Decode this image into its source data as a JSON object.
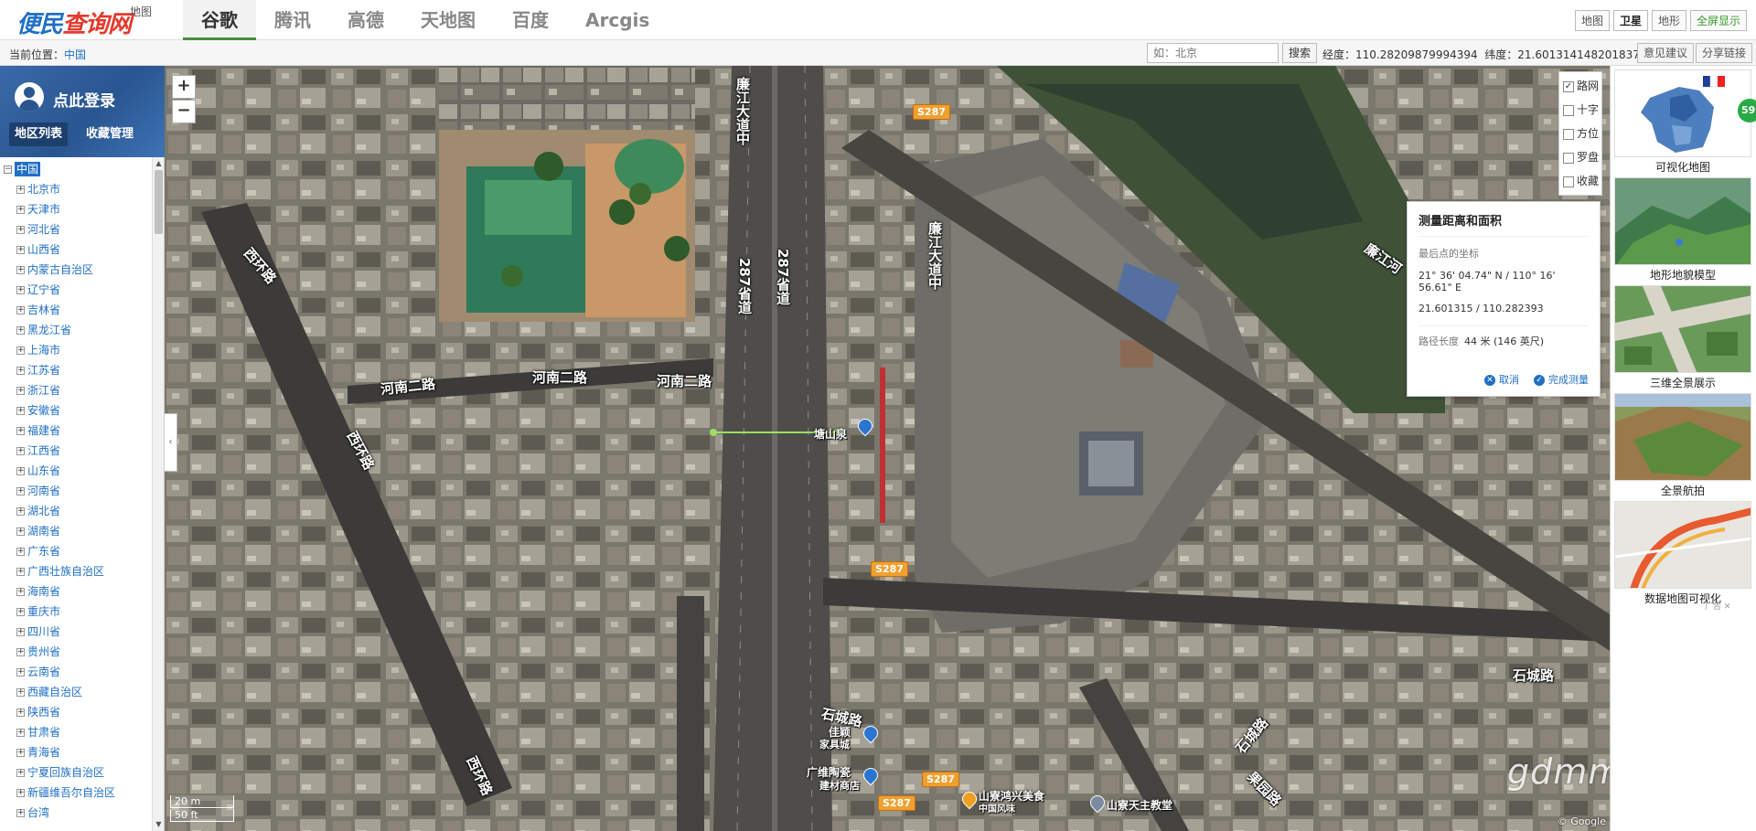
{
  "logo": {
    "text_a": "便民",
    "text_b": "查询网",
    "sub": "地图"
  },
  "tabs": [
    {
      "label": "谷歌",
      "active": true
    },
    {
      "label": "腾讯"
    },
    {
      "label": "高德"
    },
    {
      "label": "天地图"
    },
    {
      "label": "百度"
    },
    {
      "label": "Arcgis"
    }
  ],
  "view_buttons": {
    "map": "地图",
    "satellite": "卫星",
    "terrain": "地形",
    "fullscreen": "全屏显示"
  },
  "location_bar": {
    "label": "当前位置：",
    "value": "中国",
    "search_placeholder": "如：北京",
    "search_button": "搜索",
    "lng_label": "经度：",
    "lng": "110.28209879994394",
    "lat_label": "纬度：",
    "lat": "21.601314148201837",
    "feedback": "意见建议",
    "share": "分享链接"
  },
  "sidebar": {
    "login": "点此登录",
    "region_list": "地区列表",
    "favorites": "收藏管理",
    "root": "中国",
    "provinces": [
      "北京市",
      "天津市",
      "河北省",
      "山西省",
      "内蒙古自治区",
      "辽宁省",
      "吉林省",
      "黑龙江省",
      "上海市",
      "江苏省",
      "浙江省",
      "安徽省",
      "福建省",
      "江西省",
      "山东省",
      "河南省",
      "湖北省",
      "湖南省",
      "广东省",
      "广西壮族自治区",
      "海南省",
      "重庆市",
      "四川省",
      "贵州省",
      "云南省",
      "西藏自治区",
      "陕西省",
      "甘肃省",
      "青海省",
      "宁夏回族自治区",
      "新疆维吾尔自治区",
      "台湾"
    ]
  },
  "map": {
    "zoom_in": "+",
    "zoom_out": "−",
    "collapse": "‹",
    "layers": [
      {
        "label": "路网",
        "checked": true
      },
      {
        "label": "十字",
        "checked": false
      },
      {
        "label": "方位",
        "checked": false
      },
      {
        "label": "罗盘",
        "checked": false
      },
      {
        "label": "收藏",
        "checked": false
      }
    ],
    "labels": {
      "road_lianjiang_1": "廉江大道中",
      "road_lianjiang_2": "廉江大道中",
      "road_287_1": "287省道",
      "road_287_2": "287省道",
      "road_henan_1": "河南二路",
      "road_henan_2": "河南二路",
      "road_henan_3": "河南二路",
      "road_xihuan_1": "西环路",
      "road_xihuan_2": "西环路",
      "road_xihuan_3": "西环路",
      "river": "廉江河",
      "road_shicheng_1": "石城路",
      "road_shicheng_2": "石城路",
      "road_shicheng_3": "石城路",
      "road_guoyuan": "果园路"
    },
    "shields": [
      "S287",
      "S287",
      "S287",
      "S287"
    ],
    "pois": {
      "tangshanquan": "塘山泉",
      "jiaying_1": "佳颖",
      "jiaying_2": "家具城",
      "guangwei_1": "广维陶瓷",
      "guangwei_2": "建材商店",
      "shanliao_food_1": "山寮鸿兴美食",
      "shanliao_food_2": "中国风味",
      "church": "山寮天主教堂"
    },
    "measure": {
      "title": "测量距离和面积",
      "last_point_label": "最后点的坐标",
      "dms": "21° 36' 04.74\" N / 110° 16' 56.61\" E",
      "decimal": "21.601315 / 110.282393",
      "length_label": "路径长度",
      "length_value": "44 米 (146 英尺)",
      "cancel": "取消",
      "done": "完成测量"
    },
    "scale_m": "20 m",
    "scale_ft": "50 ft",
    "copyright": "© Google",
    "watermark": "gdmm.com"
  },
  "right_panel": [
    {
      "caption": "可视化地图",
      "icon": "france-map-icon"
    },
    {
      "caption": "地形地貌模型",
      "icon": "terrain-model-icon"
    },
    {
      "caption": "三维全景展示",
      "icon": "3d-panorama-icon"
    },
    {
      "caption": "全景航拍",
      "icon": "aerial-photo-icon"
    },
    {
      "caption": "数据地图可视化",
      "icon": "data-map-icon"
    }
  ],
  "badge": "59",
  "ad_tag": "广告 ✕"
}
